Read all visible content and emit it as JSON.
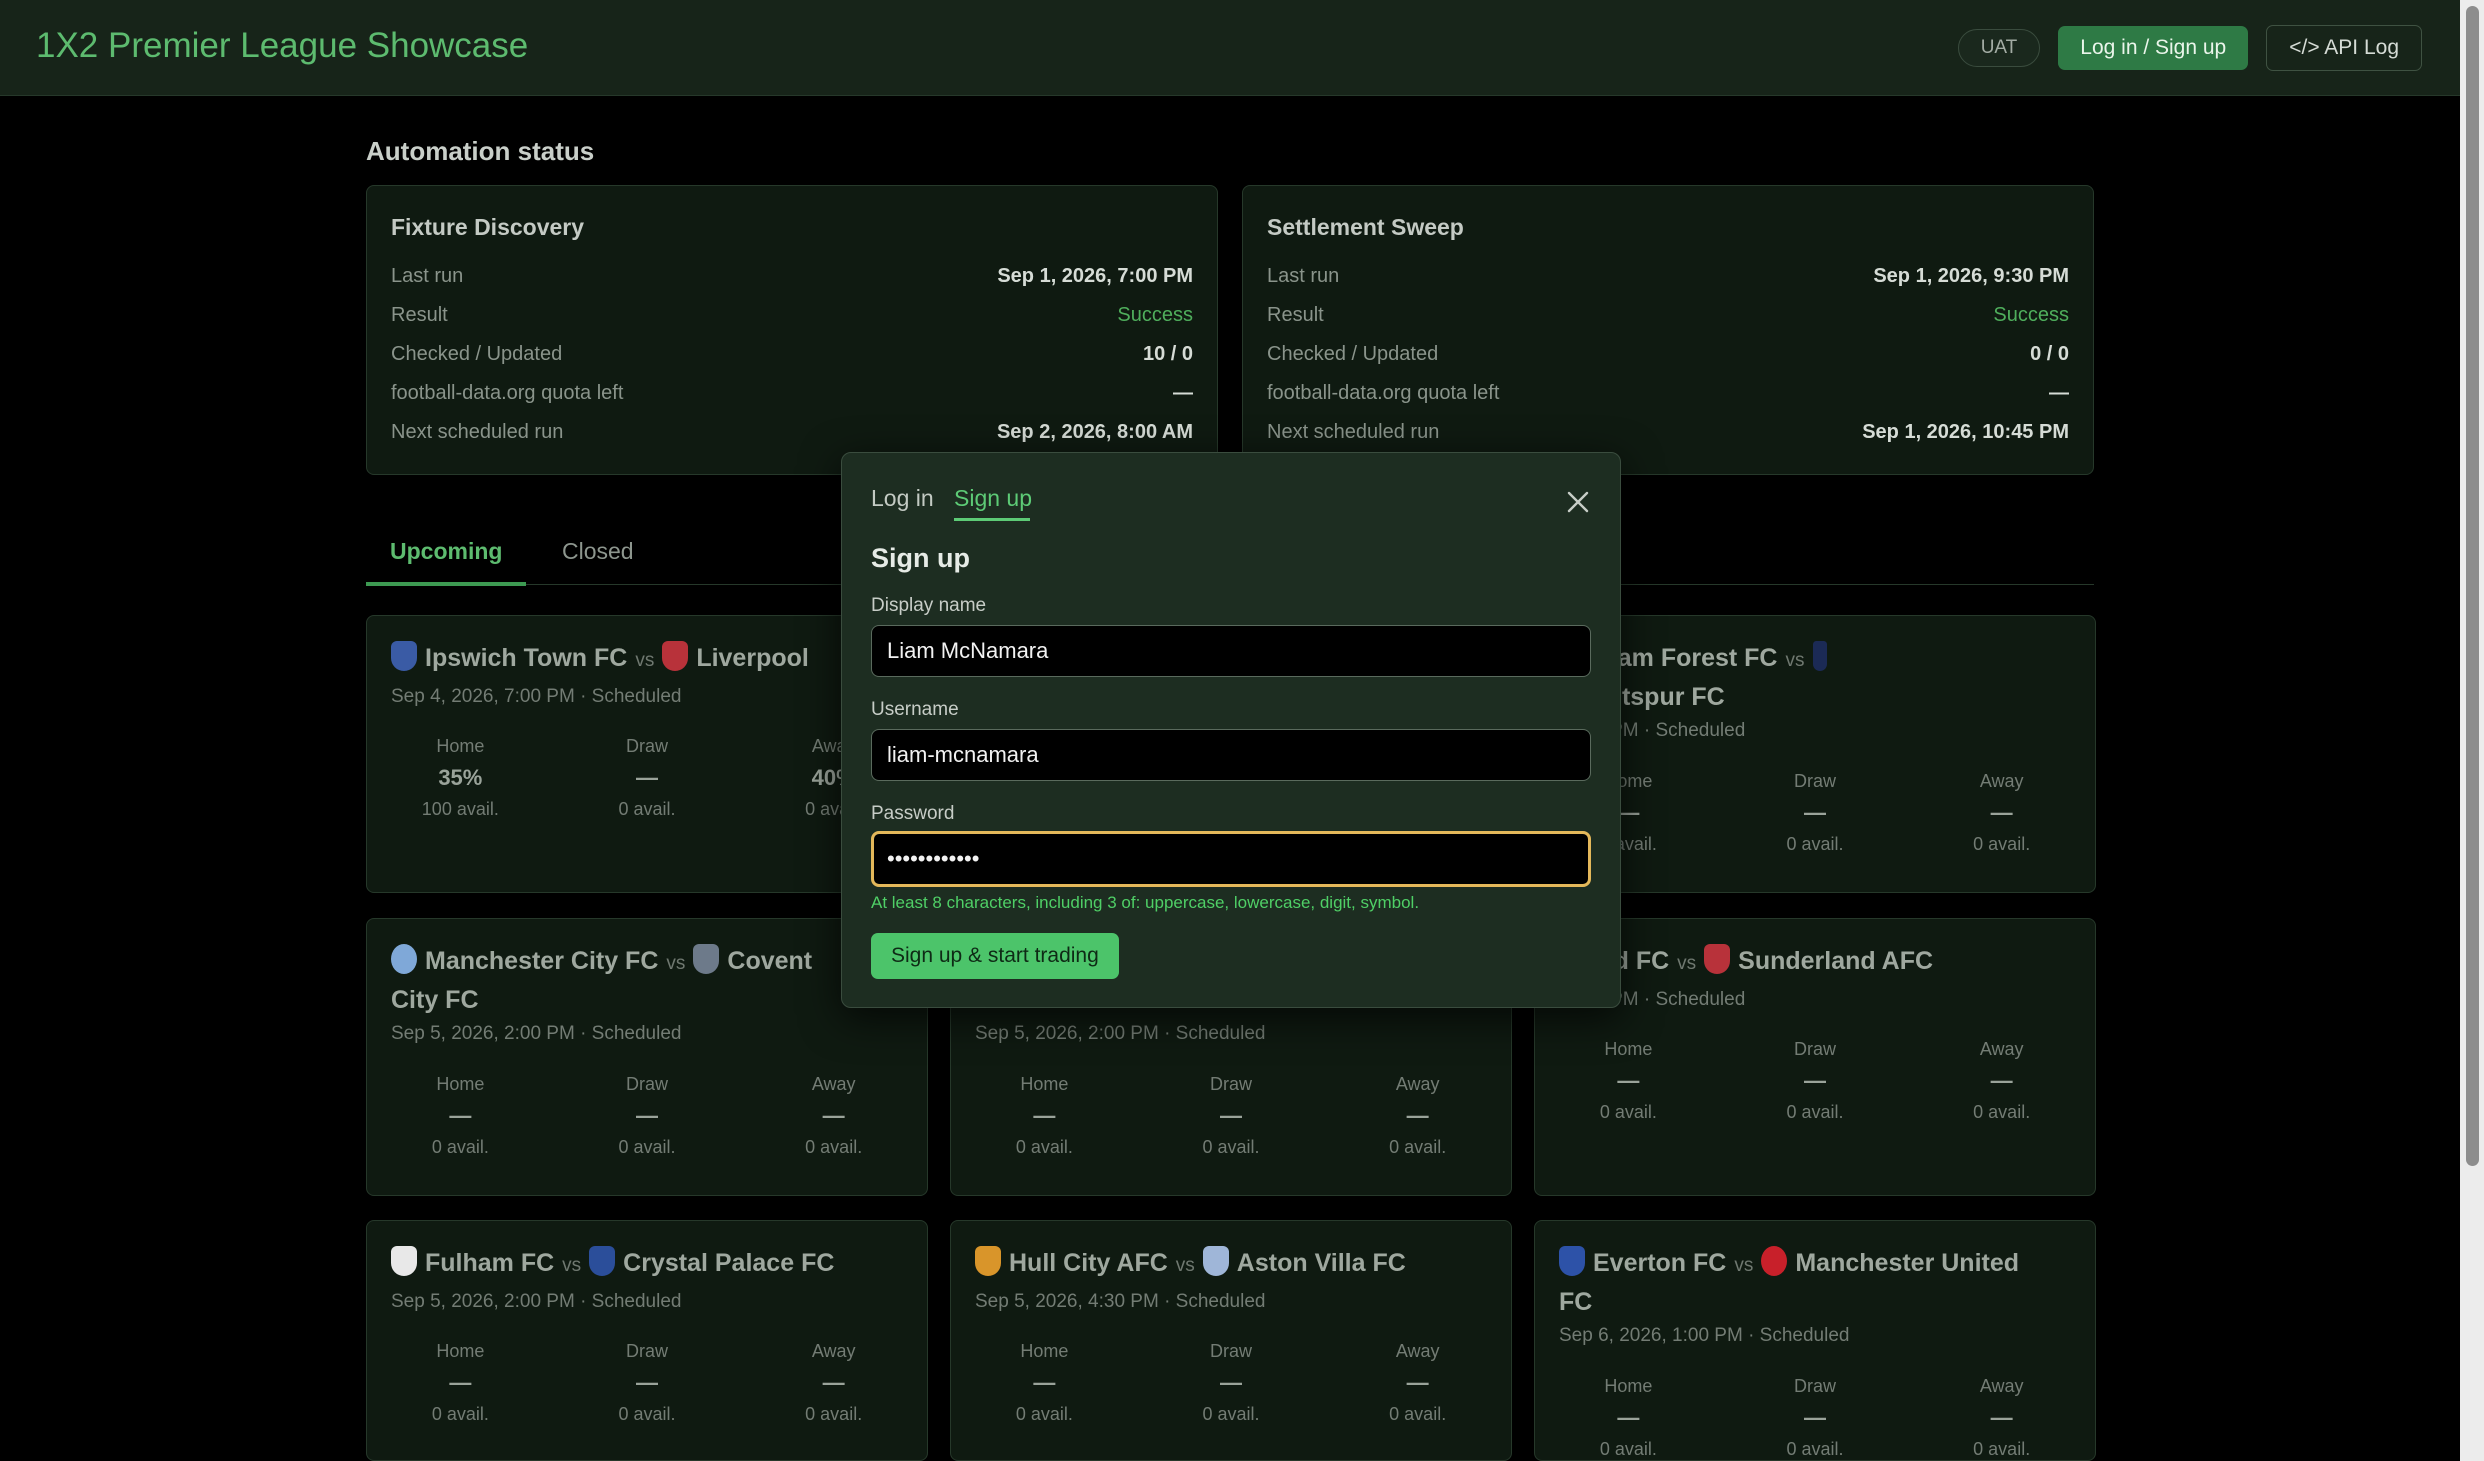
{
  "header": {
    "title": "1X2 Premier League Showcase",
    "env_badge": "UAT",
    "login_label": "Log in / Sign up",
    "api_log_label": "</> API Log"
  },
  "automation": {
    "title": "Automation status",
    "cards": [
      {
        "title": "Fixture Discovery",
        "rows": [
          {
            "key": "Last run",
            "value": "Sep 1, 2026, 7:00 PM"
          },
          {
            "key": "Result",
            "value": "Success"
          },
          {
            "key": "Checked / Updated",
            "value": "10 / 0"
          },
          {
            "key": "football-data.org quota left",
            "value": "—"
          },
          {
            "key": "Next scheduled run",
            "value": "Sep 2, 2026, 8:00 AM"
          }
        ]
      },
      {
        "title": "Settlement Sweep",
        "rows": [
          {
            "key": "Last run",
            "value": "Sep 1, 2026, 9:30 PM"
          },
          {
            "key": "Result",
            "value": "Success"
          },
          {
            "key": "Checked / Updated",
            "value": "0 / 0"
          },
          {
            "key": "football-data.org quota left",
            "value": "—"
          },
          {
            "key": "Next scheduled run",
            "value": "Sep 1, 2026, 10:45 PM"
          }
        ]
      }
    ]
  },
  "tabs": {
    "upcoming": "Upcoming",
    "closed": "Closed"
  },
  "odds_labels": {
    "home": "Home",
    "draw": "Draw",
    "away": "Away"
  },
  "matches": [
    {
      "home": "Ipswich Town FC",
      "vs": "vs",
      "away": "Liverpool",
      "meta": "Sep 4, 2026, 7:00 PM · Scheduled",
      "odds": [
        {
          "value": "35%",
          "avail": "100 avail."
        },
        {
          "value": "—",
          "avail": "0 avail."
        },
        {
          "value": "40%",
          "avail": "0 avail."
        }
      ]
    },
    {
      "home": "Nottingham Forest FC",
      "vs": "vs",
      "away": "nham Hotspur FC",
      "meta": "2026, 2:00 PM · Scheduled",
      "odds": [
        {
          "value": "—",
          "avail": "0 avail."
        },
        {
          "value": "—",
          "avail": "0 avail."
        },
        {
          "value": "—",
          "avail": "0 avail."
        }
      ]
    },
    {
      "home": "Manchester City FC",
      "vs": "vs",
      "away": "Covent",
      "tail": "City FC",
      "meta": "Sep 5, 2026, 2:00 PM · Scheduled",
      "odds": [
        {
          "value": "—",
          "avail": "0 avail."
        },
        {
          "value": "—",
          "avail": "0 avail."
        },
        {
          "value": "—",
          "avail": "0 avail."
        }
      ]
    },
    {
      "meta": "Sep 5, 2026, 2:00 PM · Scheduled",
      "odds": [
        {
          "value": "—",
          "avail": "0 avail."
        },
        {
          "value": "—",
          "avail": "0 avail."
        },
        {
          "value": "—",
          "avail": "0 avail."
        }
      ]
    },
    {
      "home": "Brentford FC",
      "vs": "vs",
      "away": "Sunderland AFC",
      "meta": "2026, 2:00 PM · Scheduled",
      "odds": [
        {
          "value": "—",
          "avail": "0 avail."
        },
        {
          "value": "—",
          "avail": "0 avail."
        },
        {
          "value": "—",
          "avail": "0 avail."
        }
      ]
    },
    {
      "home": "Fulham FC",
      "vs": "vs",
      "away": "Crystal Palace FC",
      "meta": "Sep 5, 2026, 2:00 PM · Scheduled",
      "odds": [
        {
          "value": "—",
          "avail": "0 avail."
        },
        {
          "value": "—",
          "avail": "0 avail."
        },
        {
          "value": "—",
          "avail": "0 avail."
        }
      ]
    },
    {
      "home": "Hull City AFC",
      "vs": "vs",
      "away": "Aston Villa FC",
      "meta": "Sep 5, 2026, 4:30 PM · Scheduled",
      "odds": [
        {
          "value": "—",
          "avail": "0 avail."
        },
        {
          "value": "—",
          "avail": "0 avail."
        },
        {
          "value": "—",
          "avail": "0 avail."
        }
      ]
    },
    {
      "home": "Everton FC",
      "vs": "vs",
      "away": "Manchester United",
      "tail": "FC",
      "meta": "Sep 6, 2026, 1:00 PM · Scheduled",
      "odds": [
        {
          "value": "—",
          "avail": "0 avail."
        },
        {
          "value": "—",
          "avail": "0 avail."
        },
        {
          "value": "—",
          "avail": "0 avail."
        }
      ]
    }
  ],
  "modal": {
    "tab_login": "Log in",
    "tab_signup": "Sign up",
    "title": "Sign up",
    "display_name_label": "Display name",
    "display_name_value": "Liam McNamara",
    "username_label": "Username",
    "username_value": "liam-mcnamara",
    "password_label": "Password",
    "password_value": "••••••••••••",
    "password_hint": "At least 8 characters, including 3 of: uppercase, lowercase, digit, symbol.",
    "submit_label": "Sign up & start trading"
  },
  "colors": {
    "accent": "#5dbb6f",
    "success": "#4fae5c",
    "focus_ring": "#e4b85a",
    "submit_bg": "#4cc46a"
  }
}
